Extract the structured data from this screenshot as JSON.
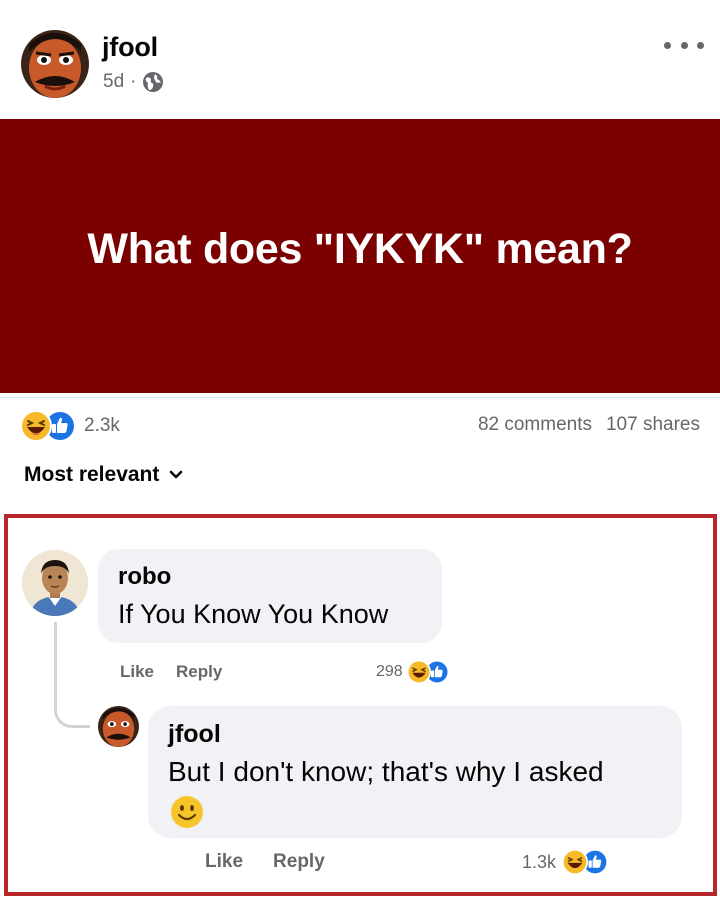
{
  "post": {
    "author": "jfool",
    "time": "5d",
    "separator": "·",
    "privacy_icon": "globe-icon",
    "more_icon": "more-horizontal-icon",
    "banner_text": "What does \"IYKYK\" mean?",
    "banner_color": "#7b0000"
  },
  "stats": {
    "reaction_icons": [
      "haha-reaction-icon",
      "like-reaction-icon"
    ],
    "reaction_count": "2.3k",
    "comments": "82 comments",
    "shares": "107 shares"
  },
  "sort": {
    "label": "Most relevant",
    "icon": "chevron-down-icon"
  },
  "comments": [
    {
      "author": "robo",
      "text": "If You Know You Know",
      "like_label": "Like",
      "reply_label": "Reply",
      "reaction_count": "298",
      "reaction_icons": [
        "haha-reaction-icon",
        "like-reaction-icon"
      ]
    },
    {
      "author": "jfool",
      "text": "But I don't know; that's why I asked",
      "emoji": "smiley-emoji",
      "like_label": "Like",
      "reply_label": "Reply",
      "reaction_count": "1.3k",
      "reaction_icons": [
        "haha-reaction-icon",
        "like-reaction-icon"
      ]
    }
  ],
  "colors": {
    "highlight_border": "#b8252a",
    "bubble": "#f0f2f5",
    "like_blue": "#1b74e4",
    "haha_yellow": "#f7b928"
  }
}
